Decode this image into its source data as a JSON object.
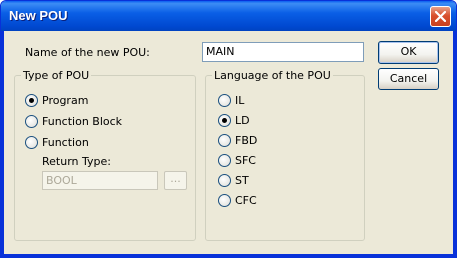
{
  "window": {
    "title": "New POU"
  },
  "name_label": "Name of the new POU:",
  "name_value": "MAIN",
  "buttons": {
    "ok": "OK",
    "cancel": "Cancel"
  },
  "type_group": {
    "legend": "Type of POU",
    "options": [
      "Program",
      "Function Block",
      "Function"
    ],
    "selected": "Program",
    "return_type_label": "Return Type:",
    "return_type_value": "BOOL",
    "browse_label": "..."
  },
  "language_group": {
    "legend": "Language of the POU",
    "options": [
      "IL",
      "LD",
      "FBD",
      "SFC",
      "ST",
      "CFC"
    ],
    "selected": "LD"
  },
  "icons": {
    "close": "close-x-icon"
  },
  "colors": {
    "titlebar": "#0A5FE6",
    "face": "#ECE9D8",
    "close_button": "#D9502D"
  }
}
